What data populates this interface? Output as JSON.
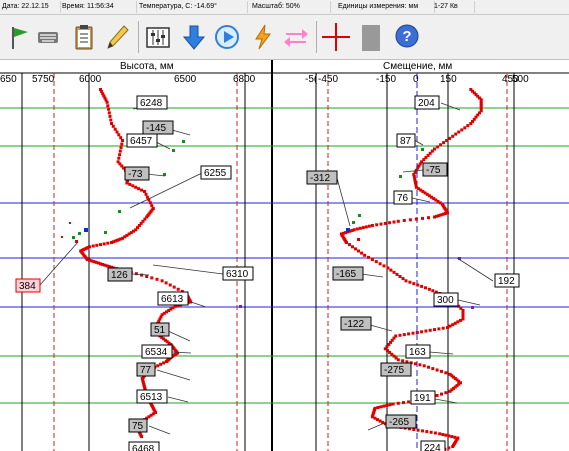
{
  "status": {
    "date_label": "Дата:",
    "date": "22.12.15",
    "time_label": "Время:",
    "time": "11:56:34",
    "temp_label": "Температура, С:",
    "temp": "-14.69°",
    "scale_label": "Масштаб:",
    "scale": "50%",
    "units_label": "Единицы измерения:",
    "units": "мм",
    "extra": "1-27 Кв"
  },
  "toolbar": {
    "buttons": [
      {
        "name": "flag-icon"
      },
      {
        "name": "keyboard-icon"
      },
      {
        "name": "clipboard-icon"
      },
      {
        "name": "pencil-icon"
      },
      {
        "name": "sliders-icon"
      },
      {
        "name": "arrow-down-icon"
      },
      {
        "name": "play-icon"
      },
      {
        "name": "lightning-icon"
      },
      {
        "name": "swap-arrows-icon"
      },
      {
        "name": "crosshair-icon"
      },
      {
        "name": "gray-square-icon"
      },
      {
        "name": "help-icon"
      }
    ]
  },
  "chart_data": [
    {
      "type": "line",
      "xlabel": "Высота, мм",
      "xticks": [
        "650",
        "5750",
        "6000",
        "6500",
        "6800"
      ],
      "xlim": [
        5650,
        6850
      ],
      "x": [
        6100,
        6130,
        6150,
        6200,
        6180,
        6230,
        6220,
        6300,
        6340,
        6310,
        6260,
        6200,
        6150,
        6050,
        6010,
        6040,
        6100,
        6160,
        6240,
        6380,
        6490,
        6510,
        6440,
        6380,
        6350,
        6370,
        6420,
        6450,
        6420,
        6400,
        6320,
        6290,
        6300,
        6310,
        6330,
        6350,
        6290,
        6270,
        6290
      ],
      "y": [
        0,
        15,
        40,
        60,
        85,
        100,
        110,
        120,
        140,
        150,
        165,
        175,
        180,
        185,
        190,
        200,
        205,
        210,
        215,
        225,
        240,
        250,
        255,
        265,
        280,
        290,
        300,
        310,
        315,
        320,
        330,
        340,
        350,
        360,
        370,
        380,
        390,
        400,
        410
      ],
      "labels": [
        {
          "text": "6248",
          "style": "white"
        },
        {
          "text": "-145",
          "style": "gray"
        },
        {
          "text": "6457",
          "style": "white"
        },
        {
          "text": "-73",
          "style": "gray"
        },
        {
          "text": "6255",
          "style": "white"
        },
        {
          "text": "384",
          "style": "pink"
        },
        {
          "text": "126",
          "style": "gray"
        },
        {
          "text": "6310",
          "style": "white"
        },
        {
          "text": "6613",
          "style": "white"
        },
        {
          "text": "51",
          "style": "gray"
        },
        {
          "text": "6534",
          "style": "white"
        },
        {
          "text": "77",
          "style": "gray"
        },
        {
          "text": "6513",
          "style": "white"
        },
        {
          "text": "75",
          "style": "gray"
        },
        {
          "text": "6468",
          "style": "white"
        }
      ]
    },
    {
      "type": "line",
      "xlabel": "Смещение, мм",
      "xticks": [
        "-5(",
        "-450",
        "-150",
        "0",
        "150",
        "450",
        "500"
      ],
      "xlim": [
        -550,
        550
      ],
      "x": [
        200,
        240,
        240,
        200,
        130,
        60,
        10,
        -20,
        -10,
        40,
        90,
        110,
        60,
        -80,
        -180,
        -250,
        -300,
        -280,
        -210,
        -120,
        -50,
        40,
        120,
        170,
        170,
        110,
        10,
        -90,
        -130,
        -80,
        20,
        120,
        160,
        120,
        20,
        -100,
        -170,
        -180,
        -120,
        -20,
        80,
        150,
        130,
        40,
        -60
      ],
      "y": [
        0,
        12,
        25,
        40,
        55,
        70,
        85,
        100,
        115,
        125,
        135,
        145,
        150,
        155,
        160,
        165,
        170,
        180,
        195,
        210,
        225,
        235,
        245,
        260,
        270,
        280,
        285,
        290,
        305,
        318,
        325,
        335,
        345,
        355,
        365,
        370,
        375,
        385,
        395,
        400,
        405,
        410,
        420,
        430,
        440
      ],
      "labels": [
        {
          "text": "204",
          "style": "white"
        },
        {
          "text": "87",
          "style": "white"
        },
        {
          "text": "-75",
          "style": "gray"
        },
        {
          "text": "-312",
          "style": "gray"
        },
        {
          "text": "76",
          "style": "white"
        },
        {
          "text": "-165",
          "style": "gray"
        },
        {
          "text": "192",
          "style": "white"
        },
        {
          "text": "300",
          "style": "white"
        },
        {
          "text": "-122",
          "style": "gray"
        },
        {
          "text": "163",
          "style": "white"
        },
        {
          "text": "-275",
          "style": "gray"
        },
        {
          "text": "191",
          "style": "white"
        },
        {
          "text": "-265",
          "style": "gray"
        },
        {
          "text": "224",
          "style": "white"
        }
      ]
    }
  ]
}
